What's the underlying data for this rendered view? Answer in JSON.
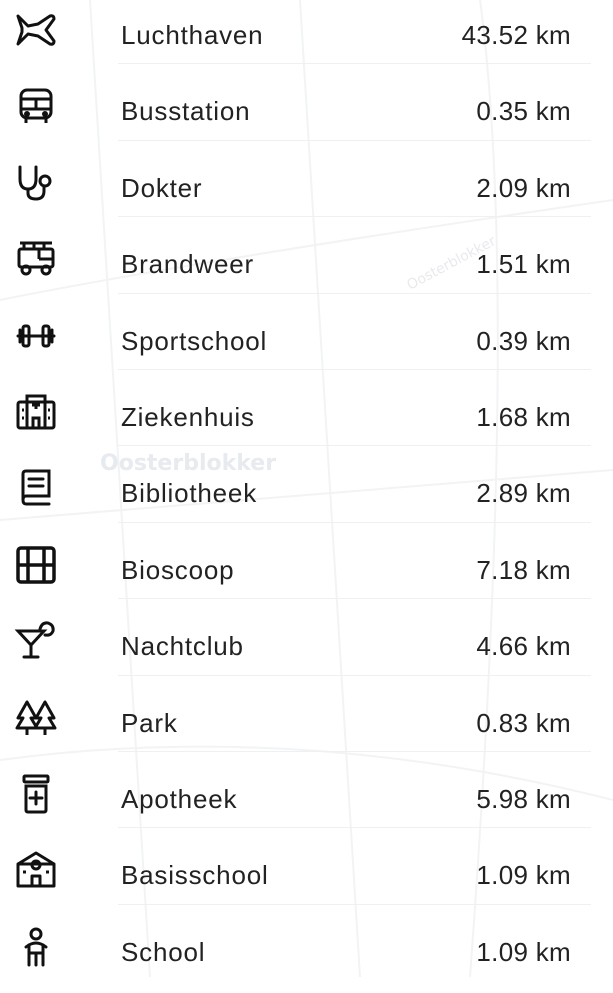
{
  "map": {
    "labels": [
      "Oosterblokker",
      "Oosterblokker"
    ]
  },
  "amenities": [
    {
      "icon": "airplane-icon",
      "label": "Luchthaven",
      "distance": "43.52 km"
    },
    {
      "icon": "bus-icon",
      "label": "Busstation",
      "distance": "0.35 km"
    },
    {
      "icon": "stethoscope-icon",
      "label": "Dokter",
      "distance": "2.09 km"
    },
    {
      "icon": "fire-truck-icon",
      "label": "Brandweer",
      "distance": "1.51 km"
    },
    {
      "icon": "dumbbell-icon",
      "label": "Sportschool",
      "distance": "0.39 km"
    },
    {
      "icon": "hospital-icon",
      "label": "Ziekenhuis",
      "distance": "1.68 km"
    },
    {
      "icon": "book-icon",
      "label": "Bibliotheek",
      "distance": "2.89 km"
    },
    {
      "icon": "film-icon",
      "label": "Bioscoop",
      "distance": "7.18 km"
    },
    {
      "icon": "cocktail-icon",
      "label": "Nachtclub",
      "distance": "4.66 km"
    },
    {
      "icon": "trees-icon",
      "label": "Park",
      "distance": "0.83 km"
    },
    {
      "icon": "pill-bottle-icon",
      "label": "Apotheek",
      "distance": "5.98 km"
    },
    {
      "icon": "school-building-icon",
      "label": "Basisschool",
      "distance": "1.09 km"
    },
    {
      "icon": "student-icon",
      "label": "School",
      "distance": "1.09 km"
    }
  ]
}
